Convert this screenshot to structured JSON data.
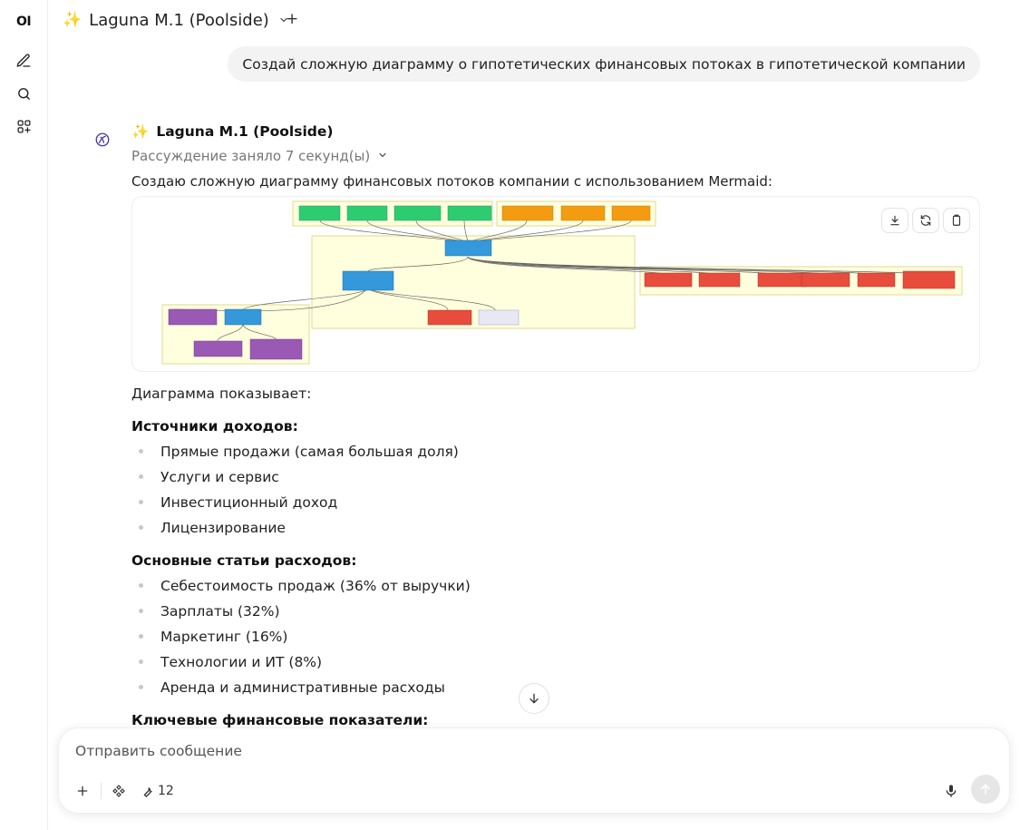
{
  "sidebar": {
    "logo": "OI"
  },
  "topbar": {
    "model_name": "Laguna M.1 (Poolside)",
    "add_label": "+"
  },
  "user_message": "Создай сложную диаграмму о гипотетических финансовых потоках в гипотетической компании",
  "assistant": {
    "name": "Laguna M.1 (Poolside)",
    "thinking": "Рассуждение заняло 7 секунд(ы)",
    "intro": "Создаю сложную диаграмму финансовых потоков компании с использованием Mermaid:",
    "diagram_shows": "Диаграмма показывает:",
    "sections": [
      {
        "title": "Источники доходов:",
        "items": [
          "Прямые продажи (самая большая доля)",
          "Услуги и сервис",
          "Инвестиционный доход",
          "Лицензирование"
        ]
      },
      {
        "title": "Основные статьи расходов:",
        "items": [
          "Себестоимость продаж (36% от выручки)",
          "Зарплаты (32%)",
          "Маркетинг (16%)",
          "Технологии и ИТ (8%)",
          "Аренда и административные расходы"
        ]
      }
    ],
    "next_heading": "Ключевые финансовые показатели:"
  },
  "diagram": {
    "income_nodes": [
      "Продажи",
      "Услуги и",
      "Инвестиционный",
      "Лицензирование"
    ],
    "other_income_nodes": [
      "Кредитные",
      "Доходы с",
      "Прочие"
    ],
    "revenue_node": "Общая выручка",
    "net_node": "Чистая прибыль",
    "expense_nodes": [
      "Себестоимость",
      "Зарплаты и",
      "Маркетинг и",
      "Аренда и",
      "Технологии и",
      "Административные"
    ],
    "mid_nodes": [
      "Процентные",
      "Налоговые"
    ],
    "dist_nodes": [
      "Фонд на прибыль",
      "Чистая прибыль",
      "Дивиденды",
      "Нераспред."
    ]
  },
  "composer": {
    "placeholder": "Отправить сообщение",
    "tools_count": "12"
  }
}
